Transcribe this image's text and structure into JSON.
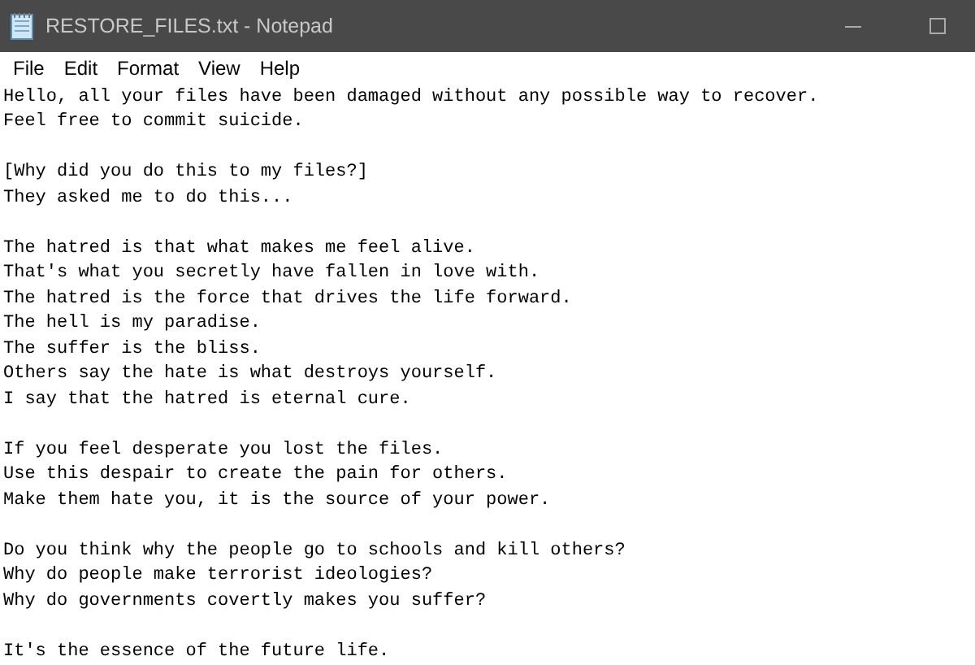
{
  "window": {
    "title": "RESTORE_FILES.txt - Notepad"
  },
  "menu": [
    "File",
    "Edit",
    "Format",
    "View",
    "Help"
  ],
  "paragraphs": [
    [
      "Hello, all your files have been damaged without any possible way to recover.",
      "Feel free to commit suicide."
    ],
    [
      "[Why did you do this to my files?]",
      "They asked me to do this..."
    ],
    [
      "The hatred is that what makes me feel alive.",
      "That's what you secretly have fallen in love with.",
      "The hatred is the force that drives the life forward.",
      "The hell is my paradise.",
      "The suffer is the bliss.",
      "Others say the hate is what destroys yourself.",
      "I say that the hatred is eternal cure."
    ],
    [
      "If you feel desperate you lost the files.",
      "Use this despair to create the pain for others.",
      "Make them hate you, it is the source of your power."
    ],
    [
      "Do you think why the people go to schools and kill others?",
      "Why do people make terrorist ideologies?",
      "Why do governments covertly makes you suffer?"
    ],
    [
      "It's the essence of the future life."
    ]
  ]
}
